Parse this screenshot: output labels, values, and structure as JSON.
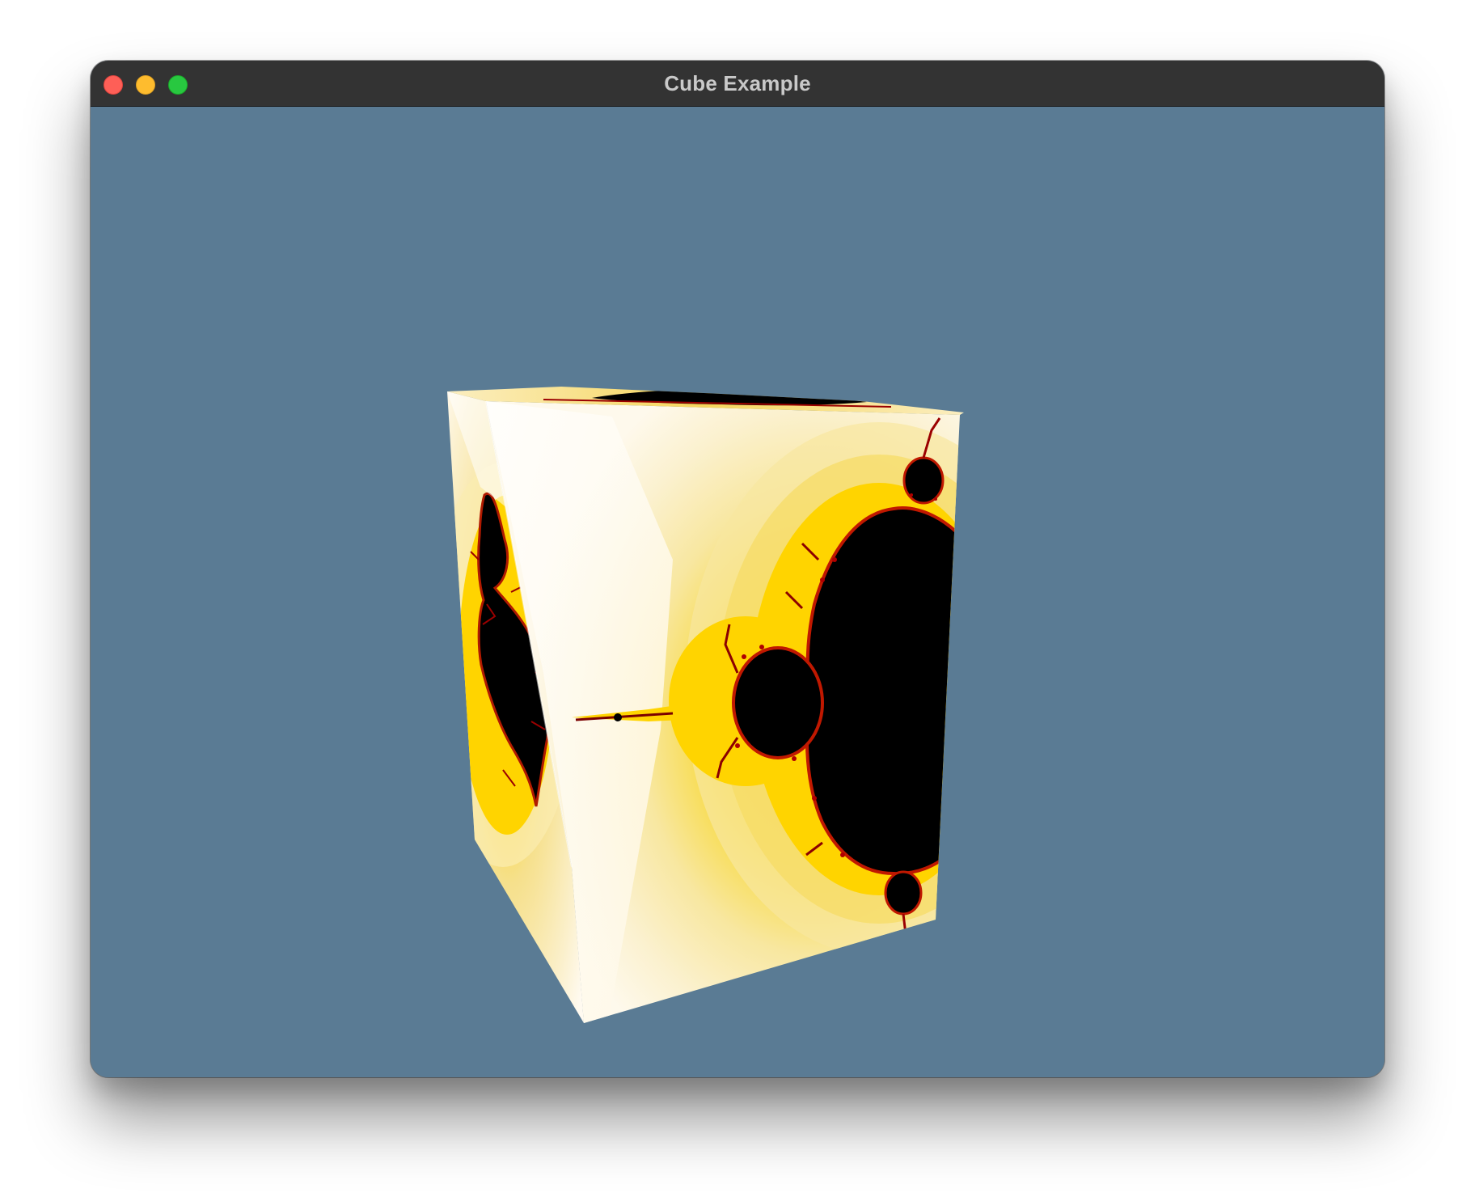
{
  "window": {
    "title": "Cube Example"
  },
  "traffic_lights": {
    "close": "close-icon",
    "minimize": "minimize-icon",
    "zoom": "zoom-icon"
  },
  "scene": {
    "background_color": "#5a7b94",
    "object": "cube",
    "texture": "mandelbrot-fractal",
    "texture_palette": [
      "#000000",
      "#8b0000",
      "#e01b00",
      "#ffd400",
      "#f8e27a",
      "#fbf0cc",
      "#ffffff"
    ]
  }
}
